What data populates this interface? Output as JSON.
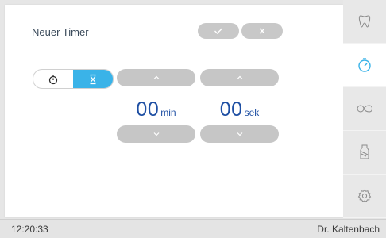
{
  "timer": {
    "title": "Neuer Timer",
    "minutes_value": "00",
    "minutes_unit": "min",
    "seconds_value": "00",
    "seconds_unit": "sek"
  },
  "mode_toggle": {
    "options": [
      "stopwatch-icon",
      "hourglass-icon"
    ],
    "selected": "hourglass-icon"
  },
  "sidebar": {
    "items": [
      {
        "icon": "tooth-icon",
        "active": false
      },
      {
        "icon": "timer-icon",
        "active": true
      },
      {
        "icon": "loop-icon",
        "active": false
      },
      {
        "icon": "bottle-icon",
        "active": false
      },
      {
        "icon": "gear-icon",
        "active": false
      }
    ]
  },
  "statusbar": {
    "time": "12:20:33",
    "user": "Dr. Kaltenbach"
  },
  "colors": {
    "accent": "#3ab3e8",
    "value_text": "#1e4fa3",
    "button_gray": "#c6c6c6"
  }
}
